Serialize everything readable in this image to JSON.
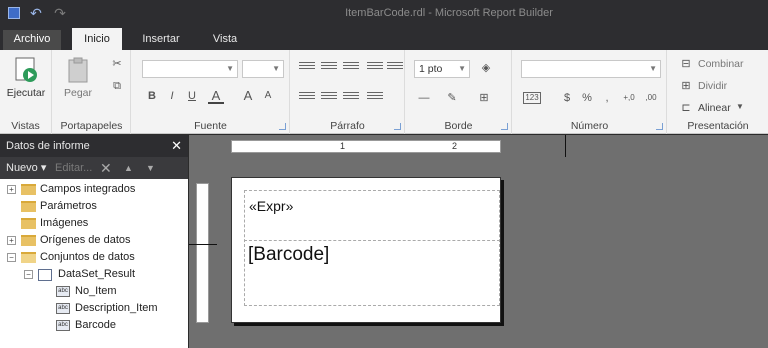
{
  "window": {
    "title": "ItemBarCode.rdl - Microsoft Report Builder"
  },
  "tabs": [
    {
      "label": "Archivo"
    },
    {
      "label": "Inicio"
    },
    {
      "label": "Insertar"
    },
    {
      "label": "Vista"
    }
  ],
  "ribbon": {
    "vistas": {
      "button": "Ejecutar",
      "label": "Vistas"
    },
    "portapapeles": {
      "button": "Pegar",
      "label": "Portapapeles"
    },
    "fuente": {
      "label": "Fuente",
      "bold": "B",
      "italic": "I",
      "underline": "U",
      "fontcolor": "A",
      "grow": "A",
      "shrink": "A"
    },
    "parrafo": {
      "label": "Párrafo"
    },
    "borde": {
      "label": "Borde",
      "width_value": "1 pto"
    },
    "numero": {
      "label": "Número",
      "currency": "$",
      "percent": "%",
      "comma": ",",
      "inc_decimal": "+,0",
      "dec_decimal": ",00"
    },
    "presentacion": {
      "label": "Presentación",
      "combinar": "Combinar",
      "dividir": "Dividir",
      "alinear": "Alinear"
    }
  },
  "panel": {
    "title": "Datos de informe",
    "new_label": "Nuevo",
    "edit_label": "Editar...",
    "tree": [
      {
        "label": "Campos integrados"
      },
      {
        "label": "Parámetros"
      },
      {
        "label": "Imágenes"
      },
      {
        "label": "Orígenes de datos"
      },
      {
        "label": "Conjuntos de datos"
      },
      {
        "label": "DataSet_Result"
      },
      {
        "label": "No_Item"
      },
      {
        "label": "Description_Item"
      },
      {
        "label": "Barcode"
      }
    ]
  },
  "ruler": {
    "marks": [
      "1",
      "2"
    ]
  },
  "report": {
    "header_text": "«Expr»",
    "body_text": "[Barcode]"
  },
  "colors": {
    "dark_chrome": "#2d2d30",
    "ribbon": "#f3f3f3",
    "surface": "#6f6f6f",
    "folder": "#e8c164"
  }
}
